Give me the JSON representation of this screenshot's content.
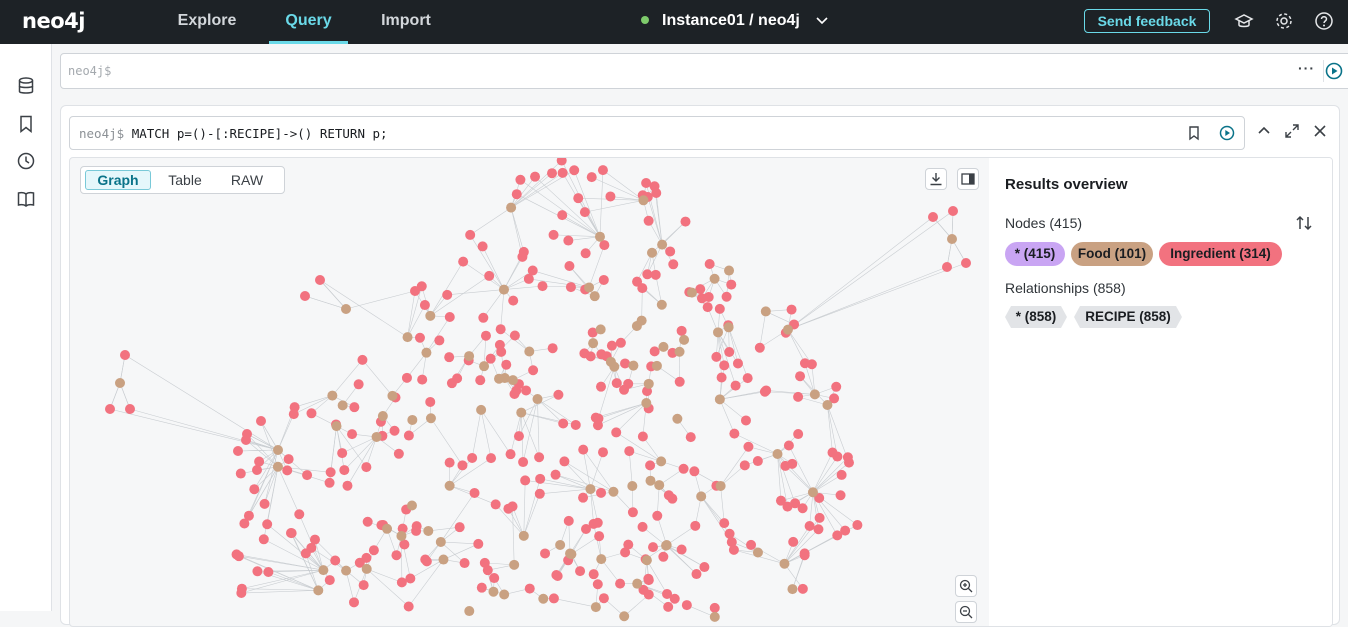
{
  "app": {
    "logo": "neo4j",
    "nav": [
      {
        "label": "Explore",
        "active": false
      },
      {
        "label": "Query",
        "active": true
      },
      {
        "label": "Import",
        "active": false
      }
    ],
    "instance": {
      "label": "Instance01 / neo4j",
      "status_color": "#7ecb6b"
    },
    "feedback_label": "Send feedback",
    "accent": "#6ad9e8"
  },
  "sidebar": {
    "icons": [
      "database-icon",
      "bookmark-icon",
      "history-icon",
      "book-icon"
    ]
  },
  "editor": {
    "prompt": "neo4j$",
    "value": ""
  },
  "frame": {
    "prompt": "neo4j$",
    "query": "MATCH p=()-[:RECIPE]->() RETURN p;",
    "view_tabs": [
      {
        "label": "Graph",
        "active": true
      },
      {
        "label": "Table",
        "active": false
      },
      {
        "label": "RAW",
        "active": false
      }
    ]
  },
  "overview": {
    "title": "Results overview",
    "nodes_label": "Nodes (415)",
    "node_chips": [
      {
        "label": "* (415)",
        "color": "#c9a5f3"
      },
      {
        "label": "Food (101)",
        "color": "#c9a182"
      },
      {
        "label": "Ingredient (314)",
        "color": "#f2727f"
      }
    ],
    "relationships_label": "Relationships (858)",
    "rel_chips": [
      {
        "label": "* (858)"
      },
      {
        "label": "RECIPE (858)"
      }
    ]
  },
  "graph": {
    "food_color": "#c9a182",
    "ingredient_color": "#f2727f",
    "food_count": 101,
    "ingredient_count": 314
  }
}
